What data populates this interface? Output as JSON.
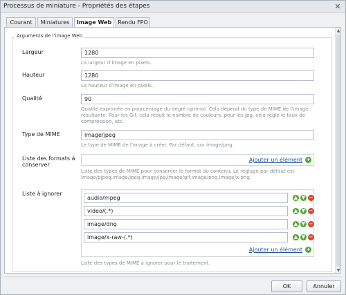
{
  "window": {
    "title": "Processus de miniature - Propriétés des étapes",
    "close_glyph": "✕"
  },
  "tabs": [
    {
      "label": "Courant"
    },
    {
      "label": "Miniatures"
    },
    {
      "label": "Image Web"
    },
    {
      "label": "Rendu FPO"
    }
  ],
  "section": {
    "legend": "Arguments de l’image Web"
  },
  "fields": {
    "width": {
      "label": "Largeur",
      "value": "1280",
      "help": "La largeur d’image en pixels."
    },
    "height": {
      "label": "Hauteur",
      "value": "1280",
      "help": "La hauteur d’image en pixels."
    },
    "quality": {
      "label": "Qualité",
      "value": "90",
      "help": "Qualité exprimée en pourcentage du degré optimal. Cela dépend du type de MIME de l’image résultante. Pour les Gif, cela réduit le nombre de couleurs, pour les Jpg, cela règle le taux de compression, etc."
    },
    "mime": {
      "label": "Type de MIME",
      "value": "image/jpeg",
      "help": "Le type de MIME de l’image à créer. Par défaut, sur image/png."
    },
    "keep_formats": {
      "label": "Liste des formats à conserver",
      "add_label": "Ajouter un élément",
      "help": "Liste des types de MIME pour conserver le format du contenu. Le réglage par défaut est image/pjpeg,image/jpeg,image/jpg,image/gif,image/png,image/x-png."
    },
    "ignore_list": {
      "label": "Liste à ignorer",
      "items": [
        "audio/mpeg",
        "video/(.*)",
        "image/dng",
        "image/x-raw-(.*)"
      ],
      "add_label": "Ajouter un élément",
      "help": "Liste des types de MIME à ignorer pour le traitement."
    }
  },
  "buttons": {
    "ok": "OK",
    "cancel": "Annuler"
  },
  "icons": {
    "up": "up-arrow-icon",
    "down": "down-arrow-icon",
    "remove": "remove-icon",
    "add": "add-icon"
  },
  "colors": {
    "accent_green": "#4fa832",
    "remove_red": "#d9442c",
    "link_blue": "#2455a4"
  }
}
